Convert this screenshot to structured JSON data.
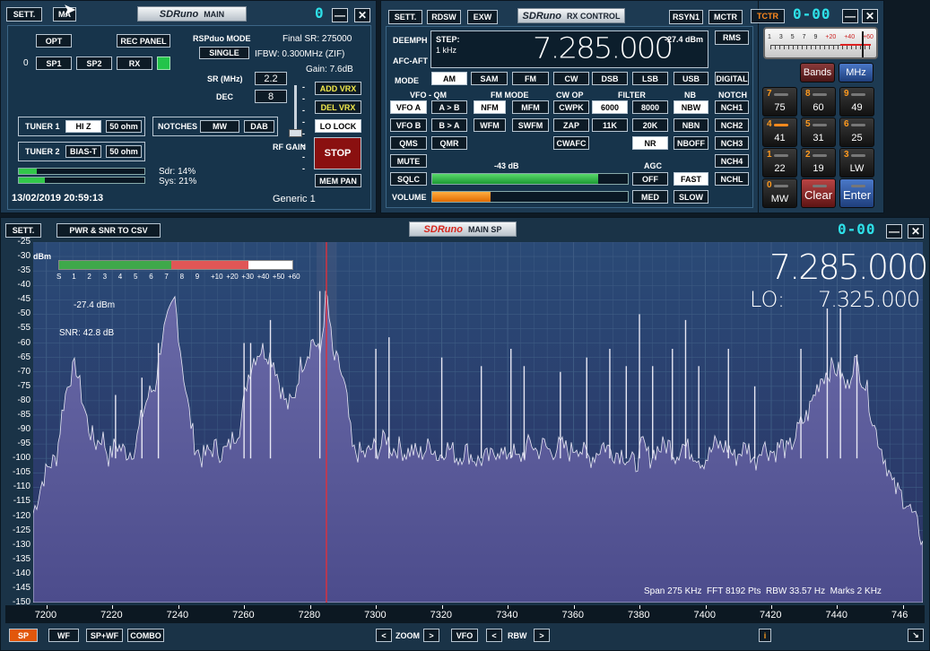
{
  "main": {
    "sett": "SETT.",
    "ma": "MA",
    "logo": "SDRuno",
    "title": "MAIN",
    "digit": "0",
    "opt": "OPT",
    "rec_panel": "REC PANEL",
    "rspduo_mode_label": "RSPduo MODE",
    "single": "SINGLE",
    "final_sr": "Final SR: 275000",
    "ifbw": "IFBW: 0.300MHz (ZIF)",
    "gain": "Gain: 7.6dB",
    "zero": "0",
    "sp1": "SP1",
    "sp2": "SP2",
    "rx": "RX",
    "sr_label": "SR (MHz)",
    "sr_value": "2.2",
    "dec_label": "DEC",
    "dec_value": "8",
    "add_vrx": "ADD VRX",
    "del_vrx": "DEL VRX",
    "lo_lock": "LO LOCK",
    "tuner1": "TUNER 1",
    "hiz": "HI Z",
    "ohm50a": "50 ohm",
    "notches": "NOTCHES",
    "mw": "MW",
    "dab": "DAB",
    "tuner2": "TUNER 2",
    "biast": "BIAS-T",
    "ohm50b": "50 ohm",
    "rf_gain": "RF GAIN",
    "stop": "STOP",
    "sdr_load": "Sdr: 14%",
    "sys_load": "Sys: 21%",
    "sdr_frac": 0.14,
    "sys_frac": 0.21,
    "mem_pan": "MEM PAN",
    "datetime": "13/02/2019 20:59:13",
    "generic": "Generic 1"
  },
  "rx": {
    "sett": "SETT.",
    "rdsw": "RDSW",
    "exw": "EXW",
    "logo": "SDRuno",
    "title": "RX CONTROL",
    "rsyn1": "RSYN1",
    "mctr": "MCTR",
    "tctr": "TCTR",
    "counter": "0-00",
    "deemph": "DEEMPH",
    "afc_aft": "AFC-AFT",
    "step_label": "STEP:",
    "step_value": "1 kHz",
    "frequency": "7.285.000",
    "dbm": "-27.4 dBm",
    "rms": "RMS",
    "mode_label": "MODE",
    "modes": [
      "AM",
      "SAM",
      "FM",
      "CW",
      "DSB",
      "LSB",
      "USB",
      "DIGITAL"
    ],
    "vfo_qm": "VFO - QM",
    "fm_mode": "FM MODE",
    "cw_op": "CW OP",
    "filter": "FILTER",
    "nb": "NB",
    "notch": "NOTCH",
    "vfo_a": "VFO A",
    "a_to_b": "A > B",
    "nfm": "NFM",
    "mfm": "MFM",
    "cwpk": "CWPK",
    "f6000": "6000",
    "f8000": "8000",
    "nbw": "NBW",
    "nch1": "NCH1",
    "vfo_b": "VFO B",
    "b_to_a": "B > A",
    "wfm": "WFM",
    "swfm": "SWFM",
    "zap": "ZAP",
    "f11k": "11K",
    "f20k": "20K",
    "nbn": "NBN",
    "nch2": "NCH2",
    "qms": "QMS",
    "qmr": "QMR",
    "cwafc": "CWAFC",
    "nr": "NR",
    "nboff": "NBOFF",
    "nch3": "NCH3",
    "mute": "MUTE",
    "sqlc_db": "-43 dB",
    "agc": "AGC",
    "nch4": "NCH4",
    "sqlc": "SQLC",
    "off": "OFF",
    "fast": "FAST",
    "nchl": "NCHL",
    "volume": "VOLUME",
    "med": "MED",
    "slow": "SLOW",
    "sqlc_frac": 0.85,
    "volume_frac": 0.3,
    "meter_scale": [
      "1",
      "3",
      "5",
      "7",
      "9",
      "+20",
      "+40",
      "+60"
    ],
    "keypad": [
      {
        "n": "",
        "v": "Bands"
      },
      {
        "n": "",
        "v": "MHz"
      },
      {
        "n": "7",
        "v": "75"
      },
      {
        "n": "8",
        "v": "60"
      },
      {
        "n": "9",
        "v": "49"
      },
      {
        "n": "4",
        "v": "41"
      },
      {
        "n": "5",
        "v": "31"
      },
      {
        "n": "6",
        "v": "25"
      },
      {
        "n": "1",
        "v": "22"
      },
      {
        "n": "2",
        "v": "19"
      },
      {
        "n": "3",
        "v": "LW"
      },
      {
        "n": "0",
        "v": "MW"
      },
      {
        "n": "",
        "v": "Clear"
      },
      {
        "n": "",
        "v": "Enter"
      }
    ]
  },
  "sp": {
    "sett": "SETT.",
    "csv": "PWR & SNR TO CSV",
    "logo": "SDRuno",
    "title": "MAIN SP",
    "counter": "0-00",
    "dbm_unit": "dBm",
    "level": "-27.4 dBm",
    "snr": "SNR: 42.8 dB",
    "frequency": "7.285.000",
    "lo_label": "LO:",
    "lo_value": "7.325.000",
    "info": "Span 275 KHz  FFT 8192 Pts  RBW 33.57 Hz  Marks 2 KHz",
    "s_scale": [
      "S",
      "1",
      "2",
      "3",
      "4",
      "5",
      "6",
      "7",
      "8",
      "9",
      "+10",
      "+20",
      "+30",
      "+40",
      "+50",
      "+60"
    ],
    "s_meter_frac": 0.81,
    "y_ticks": [
      "-25",
      "-30",
      "-35",
      "-40",
      "-45",
      "-50",
      "-55",
      "-60",
      "-65",
      "-70",
      "-75",
      "-80",
      "-85",
      "-90",
      "-95",
      "-100",
      "-105",
      "-110",
      "-115",
      "-120",
      "-125",
      "-130",
      "-135",
      "-140",
      "-145",
      "-150"
    ],
    "x_ticks": [
      "7200",
      "7220",
      "7240",
      "7260",
      "7280",
      "7300",
      "7320",
      "7340",
      "7360",
      "7380",
      "7400",
      "7420",
      "7440",
      "746"
    ],
    "bottom": {
      "sp": "SP",
      "wf": "WF",
      "spwf": "SP+WF",
      "combo": "COMBO",
      "zoom": "ZOOM",
      "vfo": "VFO",
      "rbw": "RBW",
      "info_btn": "i"
    }
  },
  "chart_data": {
    "type": "line",
    "title": "",
    "xlabel": "",
    "ylabel": "dBm",
    "xlim": [
      7196,
      7466
    ],
    "ylim": [
      -150,
      -25
    ],
    "x_unit": "kHz",
    "series": [
      {
        "x": [
          7196,
          7197,
          7199,
          7201,
          7203,
          7205,
          7207,
          7209,
          7211,
          7213,
          7215,
          7217,
          7219,
          7221,
          7223,
          7225,
          7227,
          7229,
          7231,
          7233,
          7235,
          7237,
          7239,
          7241,
          7243,
          7245,
          7247,
          7249,
          7251,
          7253,
          7255,
          7257,
          7259,
          7261,
          7263,
          7265,
          7267,
          7269,
          7271,
          7273,
          7275,
          7277,
          7279,
          7281,
          7283,
          7285,
          7287,
          7289,
          7291,
          7293,
          7295,
          7297,
          7299,
          7301,
          7303,
          7305,
          7307,
          7309,
          7311,
          7313,
          7315,
          7317,
          7319,
          7321,
          7323,
          7325,
          7327,
          7329,
          7331,
          7333,
          7335,
          7337,
          7339,
          7341,
          7343,
          7345,
          7347,
          7349,
          7351,
          7353,
          7355,
          7357,
          7359,
          7361,
          7363,
          7365,
          7367,
          7369,
          7371,
          7373,
          7375,
          7377,
          7379,
          7381,
          7383,
          7385,
          7387,
          7389,
          7391,
          7393,
          7395,
          7397,
          7399,
          7401,
          7403,
          7405,
          7407,
          7409,
          7411,
          7413,
          7415,
          7417,
          7419,
          7421,
          7423,
          7425,
          7427,
          7429,
          7431,
          7433,
          7435,
          7437,
          7439,
          7441,
          7443,
          7445,
          7447,
          7449,
          7451,
          7453,
          7455,
          7457,
          7459,
          7461,
          7463,
          7465,
          7466
        ],
        "y": [
          -119,
          -115,
          -107,
          -102,
          -100,
          -82,
          -72,
          -68,
          -80,
          -90,
          -95,
          -92,
          -100,
          -95,
          -97,
          -98,
          -96,
          -85,
          -78,
          -75,
          -58,
          -52,
          -45,
          -65,
          -82,
          -95,
          -100,
          -98,
          -96,
          -98,
          -97,
          -92,
          -88,
          -72,
          -65,
          -62,
          -63,
          -66,
          -75,
          -82,
          -80,
          -68,
          -64,
          -58,
          -65,
          -42,
          -65,
          -68,
          -78,
          -98,
          -98,
          -99,
          -96,
          -97,
          -92,
          -97,
          -96,
          -98,
          -97,
          -99,
          -97,
          -95,
          -100,
          -96,
          -97,
          -100,
          -97,
          -99,
          -101,
          -100,
          -100,
          -96,
          -100,
          -96,
          -101,
          -98,
          -94,
          -98,
          -95,
          -98,
          -96,
          -96,
          -98,
          -95,
          -98,
          -100,
          -98,
          -95,
          -97,
          -98,
          -98,
          -101,
          -102,
          -95,
          -100,
          -97,
          -96,
          -95,
          -99,
          -95,
          -97,
          -98,
          -101,
          -99,
          -95,
          -96,
          -96,
          -100,
          -97,
          -96,
          -102,
          -95,
          -97,
          -98,
          -95,
          -98,
          -93,
          -88,
          -85,
          -78,
          -72,
          -70,
          -68,
          -71,
          -76,
          -66,
          -70,
          -76,
          -88,
          -95,
          -102,
          -110,
          -112,
          -115,
          -120,
          -125,
          -130
        ]
      }
    ],
    "grid": true,
    "marker_x": 7285
  }
}
